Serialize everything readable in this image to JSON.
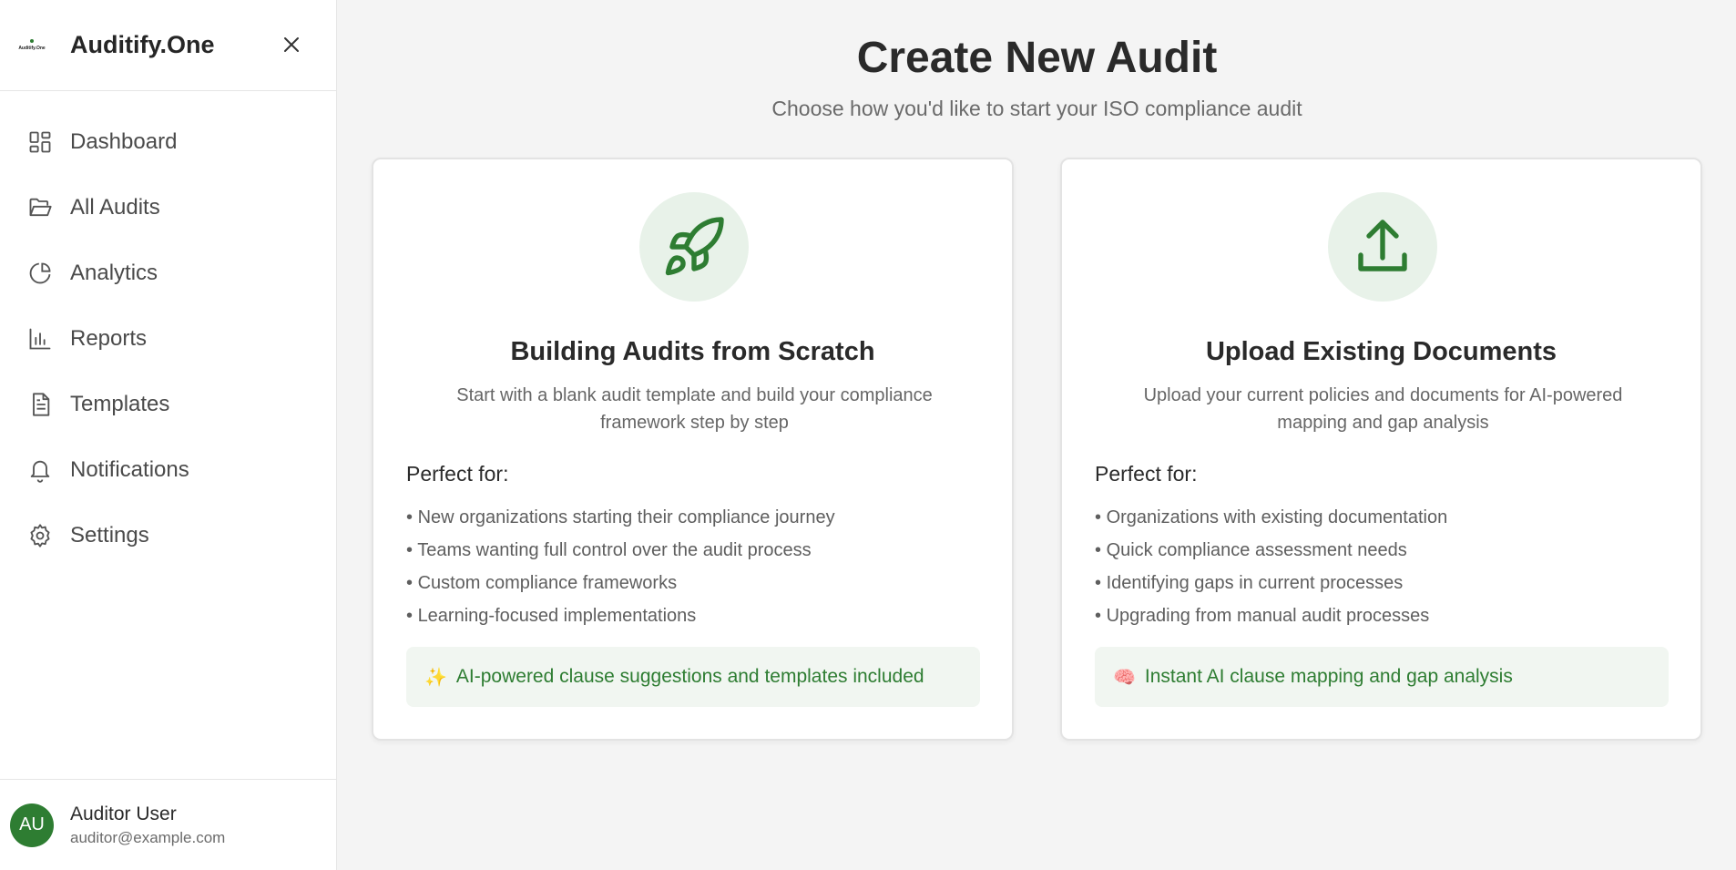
{
  "app": {
    "name": "Auditify.One",
    "logo_text": "Auditify.One"
  },
  "sidebar": {
    "items": [
      {
        "label": "Dashboard",
        "icon": "dashboard-icon"
      },
      {
        "label": "All Audits",
        "icon": "folder-open-icon"
      },
      {
        "label": "Analytics",
        "icon": "pie-chart-icon"
      },
      {
        "label": "Reports",
        "icon": "bar-chart-icon"
      },
      {
        "label": "Templates",
        "icon": "document-icon"
      },
      {
        "label": "Notifications",
        "icon": "bell-icon"
      },
      {
        "label": "Settings",
        "icon": "gear-icon"
      }
    ]
  },
  "user": {
    "initials": "AU",
    "name": "Auditor User",
    "email": "auditor@example.com"
  },
  "main": {
    "title": "Create New Audit",
    "subtitle": "Choose how you'd like to start your ISO compliance audit",
    "cards": [
      {
        "icon": "rocket-icon",
        "title": "Building Audits from Scratch",
        "description": "Start with a blank audit template and build your compliance framework step by step",
        "perfect_for_label": "Perfect for:",
        "bullets": [
          "New organizations starting their compliance journey",
          "Teams wanting full control over the audit process",
          "Custom compliance frameworks",
          "Learning-focused implementations"
        ],
        "highlight_emoji": "✨",
        "highlight": "AI-powered clause suggestions and templates included"
      },
      {
        "icon": "upload-icon",
        "title": "Upload Existing Documents",
        "description": "Upload your current policies and documents for AI-powered mapping and gap analysis",
        "perfect_for_label": "Perfect for:",
        "bullets": [
          "Organizations with existing documentation",
          "Quick compliance assessment needs",
          "Identifying gaps in current processes",
          "Upgrading from manual audit processes"
        ],
        "highlight_emoji": "🧠",
        "highlight": "Instant AI clause mapping and gap analysis"
      }
    ]
  },
  "colors": {
    "accent": "#2e7d32",
    "accent_bg": "#e8f2e9",
    "highlight_bg": "#f1f6f1"
  }
}
